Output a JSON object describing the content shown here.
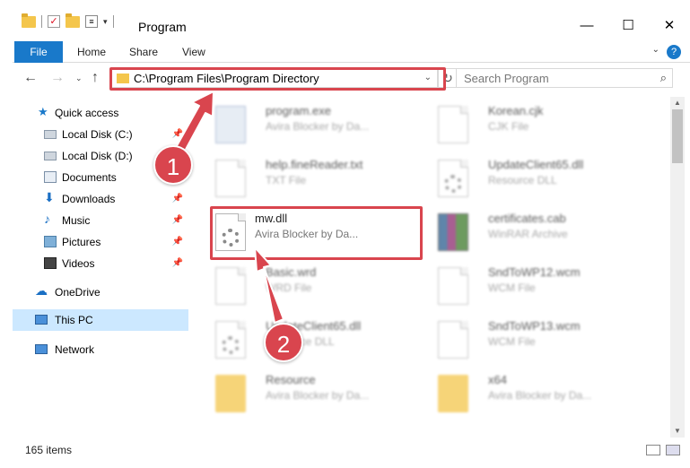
{
  "window": {
    "title": "Program",
    "controls": {
      "minimize": "—",
      "maximize": "☐",
      "close": "✕"
    }
  },
  "ribbon": {
    "tabs": [
      "File",
      "Home",
      "Share",
      "View"
    ],
    "help": "?"
  },
  "address": {
    "path": "C:\\Program Files\\Program Directory",
    "search_placeholder": "Search Program"
  },
  "sidebar": {
    "items": [
      {
        "label": "Quick access",
        "icon": "star-icon",
        "pinned": false
      },
      {
        "label": "Local Disk (C:)",
        "icon": "drive-icon",
        "pinned": true
      },
      {
        "label": "Local Disk (D:)",
        "icon": "drive-icon",
        "pinned": false
      },
      {
        "label": "Documents",
        "icon": "documents-icon",
        "pinned": true
      },
      {
        "label": "Downloads",
        "icon": "downloads-icon",
        "pinned": true
      },
      {
        "label": "Music",
        "icon": "music-icon",
        "pinned": true
      },
      {
        "label": "Pictures",
        "icon": "pictures-icon",
        "pinned": true
      },
      {
        "label": "Videos",
        "icon": "videos-icon",
        "pinned": true
      },
      {
        "label": "OneDrive",
        "icon": "cloud-icon",
        "pinned": false
      },
      {
        "label": "This PC",
        "icon": "computer-icon",
        "pinned": false,
        "selected": true
      },
      {
        "label": "Network",
        "icon": "network-icon",
        "pinned": false
      }
    ]
  },
  "files": [
    {
      "name": "program.exe",
      "sub": "Avira Blocker by Da...",
      "icon": "exe"
    },
    {
      "name": "Korean.cjk",
      "sub": "CJK File",
      "icon": "doc"
    },
    {
      "name": "help.fineReader.txt",
      "sub": "TXT File",
      "icon": "doc"
    },
    {
      "name": "UpdateClient65.dll",
      "sub": "Resource DLL",
      "icon": "gear"
    },
    {
      "name": "mw.dll",
      "sub": "Avira Blocker by Da...",
      "icon": "gear",
      "highlighted": true
    },
    {
      "name": "certificates.cab",
      "sub": "WinRAR Archive",
      "icon": "rar"
    },
    {
      "name": "Basic.wrd",
      "sub": "WRD File",
      "icon": "doc"
    },
    {
      "name": "SndToWP12.wcm",
      "sub": "WCM File",
      "icon": "doc"
    },
    {
      "name": "UpdateClient65.dll",
      "sub": "Resource DLL",
      "icon": "gear"
    },
    {
      "name": "SndToWP13.wcm",
      "sub": "WCM File",
      "icon": "doc"
    },
    {
      "name": "Resource",
      "sub": "Avira Blocker by Da...",
      "icon": "folder"
    },
    {
      "name": "x64",
      "sub": "Avira Blocker by Da...",
      "icon": "folder"
    }
  ],
  "annotations": {
    "step1": "1",
    "step2": "2",
    "color": "#d9454e"
  },
  "status": {
    "count": "165 items"
  }
}
